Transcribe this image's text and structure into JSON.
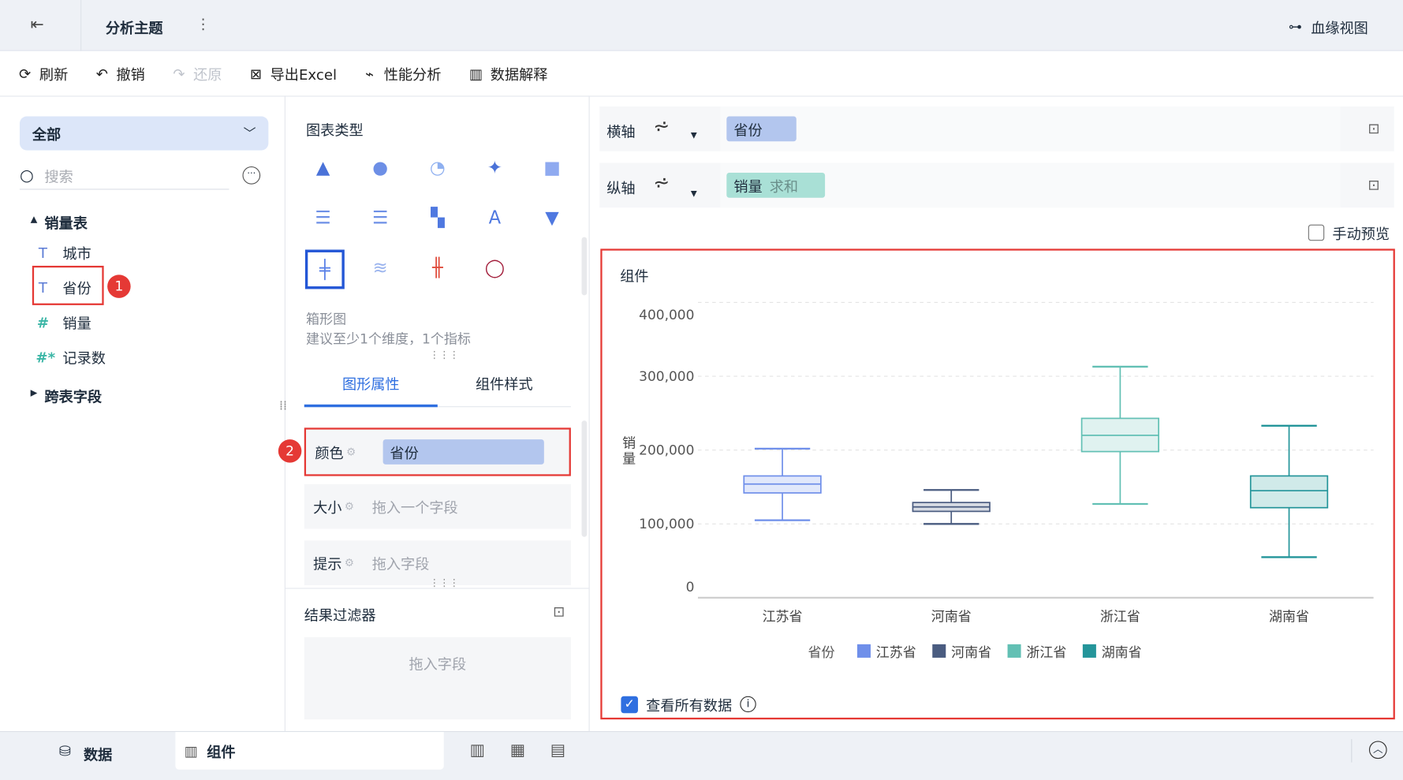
{
  "topbar": {
    "title": "分析主题",
    "lineage": "血缘视图"
  },
  "toolbar": {
    "refresh": "刷新",
    "undo": "撤销",
    "redo": "还原",
    "export": "导出Excel",
    "perf": "性能分析",
    "explain": "数据解释"
  },
  "left": {
    "scope": "全部",
    "search_placeholder": "搜索",
    "table": "销量表",
    "fields": [
      "城市",
      "省份",
      "销量",
      "记录数"
    ],
    "cross": "跨表字段",
    "badge1": "1"
  },
  "middle": {
    "chart_type_label": "图表类型",
    "chart_name": "箱形图",
    "chart_hint": "建议至少1个维度，1个指标",
    "tab_props": "图形属性",
    "tab_style": "组件样式",
    "color_label": "颜色",
    "color_value": "省份",
    "size_label": "大小",
    "size_placeholder": "拖入一个字段",
    "tip_label": "提示",
    "tip_placeholder": "拖入字段",
    "badge2": "2",
    "filter_label": "结果过滤器",
    "filter_placeholder": "拖入字段"
  },
  "axes": {
    "x_label": "横轴",
    "x_field": "省份",
    "y_label": "纵轴",
    "y_field": "销量",
    "y_agg": "求和",
    "manual_preview": "手动预览"
  },
  "widget": {
    "title": "组件",
    "view_all": "查看所有数据"
  },
  "bottom": {
    "data_tab": "数据",
    "widget_tab": "组件"
  },
  "chart_data": {
    "type": "box",
    "ylabel": "销量",
    "xlabel": "",
    "ylim": [
      0,
      400000
    ],
    "yticks": [
      "0",
      "100,000",
      "200,000",
      "300,000",
      "400,000"
    ],
    "yticks_values": [
      0,
      100000,
      200000,
      300000,
      400000
    ],
    "categories": [
      "江苏省",
      "河南省",
      "浙江省",
      "湖南省"
    ],
    "legend_title": "省份",
    "legend_position": "bottom",
    "colors": [
      "#6f8fea",
      "#4a5c80",
      "#62c0b4",
      "#24959a"
    ],
    "fills": [
      "#e1e8fb",
      "#d7dbe3",
      "#e0f2f0",
      "#d0eae9"
    ],
    "series": [
      {
        "name": "江苏省",
        "min": 105000,
        "q1": 142000,
        "median": 154000,
        "q3": 165000,
        "max": 202000
      },
      {
        "name": "河南省",
        "min": 100000,
        "q1": 117000,
        "median": 123000,
        "q3": 129000,
        "max": 146000
      },
      {
        "name": "浙江省",
        "min": 127000,
        "q1": 198000,
        "median": 220000,
        "q3": 243000,
        "max": 313000
      },
      {
        "name": "湖南省",
        "min": 55000,
        "q1": 122000,
        "median": 145000,
        "q3": 165000,
        "max": 233000
      }
    ]
  }
}
